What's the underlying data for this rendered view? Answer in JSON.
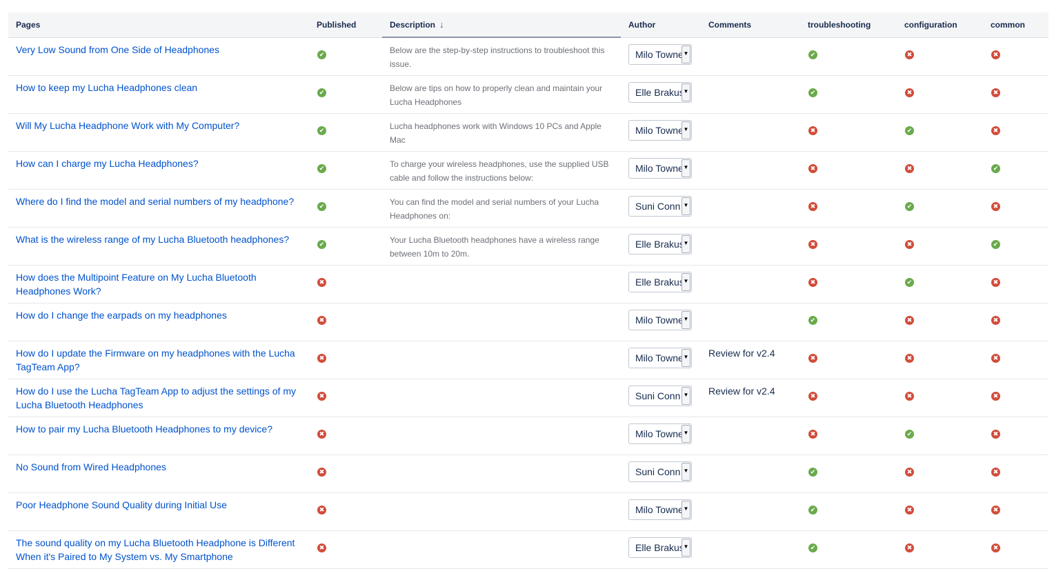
{
  "columns": {
    "pages": "Pages",
    "published": "Published",
    "description": "Description",
    "author": "Author",
    "comments": "Comments",
    "troubleshooting": "troubleshooting",
    "configuration": "configuration",
    "common": "common"
  },
  "sort": {
    "column": "description",
    "direction": "descending",
    "icon": "arrow-down-icon",
    "glyph": "↓"
  },
  "colors": {
    "link": "#0052cc",
    "yes": "#6aaa4c",
    "no": "#d14c3a"
  },
  "status_glyphs": {
    "yes": "✔",
    "no": "✖"
  },
  "rows": [
    {
      "page": "Very Low Sound from One Side of Headphones",
      "published": "yes",
      "description": "Below are the step-by-step instructions to troubleshoot this issue.",
      "author": "Milo Towne",
      "comments": "",
      "troubleshooting": "yes",
      "configuration": "no",
      "common": "no"
    },
    {
      "page": "How to keep my Lucha Headphones clean",
      "published": "yes",
      "description": "Below are tips on how to properly clean and maintain your Lucha Headphones",
      "author": "Elle Brakus",
      "comments": "",
      "troubleshooting": "yes",
      "configuration": "no",
      "common": "no"
    },
    {
      "page": "Will My Lucha Headphone Work with My Computer?",
      "published": "yes",
      "description": "Lucha headphones work with Windows 10 PCs and Apple Mac",
      "author": "Milo Towne",
      "comments": "",
      "troubleshooting": "no",
      "configuration": "yes",
      "common": "no"
    },
    {
      "page": "How can I charge my Lucha Headphones?",
      "published": "yes",
      "description": "To charge your wireless headphones, use the supplied USB cable and follow the instructions below:",
      "author": "Milo Towne",
      "comments": "",
      "troubleshooting": "no",
      "configuration": "no",
      "common": "yes"
    },
    {
      "page": "Where do I find the model and serial numbers of my headphone?",
      "published": "yes",
      "description": "You can find the model and serial numbers of your Lucha Headphones on:",
      "author": "Suni Conn",
      "comments": "",
      "troubleshooting": "no",
      "configuration": "yes",
      "common": "no"
    },
    {
      "page": "What is the wireless range of my Lucha Bluetooth headphones?",
      "published": "yes",
      "description": "Your Lucha Bluetooth headphones have a wireless range between 10m to 20m.",
      "author": "Elle Brakus",
      "comments": "",
      "troubleshooting": "no",
      "configuration": "no",
      "common": "yes"
    },
    {
      "page": "How does the Multipoint Feature on My Lucha Bluetooth Headphones Work?",
      "published": "no",
      "description": "",
      "author": "Elle Brakus",
      "comments": "",
      "troubleshooting": "no",
      "configuration": "yes",
      "common": "no"
    },
    {
      "page": "How do I change the earpads on my headphones",
      "published": "no",
      "description": "",
      "author": "Milo Towne",
      "comments": "",
      "troubleshooting": "yes",
      "configuration": "no",
      "common": "no"
    },
    {
      "page": "How do I update the Firmware on my headphones with the Lucha TagTeam App?",
      "published": "no",
      "description": "",
      "author": "Milo Towne",
      "comments": "Review for v2.4",
      "troubleshooting": "no",
      "configuration": "no",
      "common": "no"
    },
    {
      "page": "How do I use the Lucha TagTeam App to adjust the settings of my Lucha Bluetooth Headphones",
      "published": "no",
      "description": "",
      "author": "Suni Conn",
      "comments": "Review for v2.4",
      "troubleshooting": "no",
      "configuration": "no",
      "common": "no"
    },
    {
      "page": "How to pair my Lucha Bluetooth Headphones to my device?",
      "published": "no",
      "description": "",
      "author": "Milo Towne",
      "comments": "",
      "troubleshooting": "no",
      "configuration": "yes",
      "common": "no"
    },
    {
      "page": "No Sound from Wired Headphones",
      "published": "no",
      "description": "",
      "author": "Suni Conn",
      "comments": "",
      "troubleshooting": "yes",
      "configuration": "no",
      "common": "no"
    },
    {
      "page": "Poor Headphone Sound Quality during Initial Use",
      "published": "no",
      "description": "",
      "author": "Milo Towne",
      "comments": "",
      "troubleshooting": "yes",
      "configuration": "no",
      "common": "no"
    },
    {
      "page": "The sound quality on my Lucha Bluetooth Headphone is Different When it's Paired to My System vs. My Smartphone",
      "published": "no",
      "description": "",
      "author": "Elle Brakus",
      "comments": "",
      "troubleshooting": "yes",
      "configuration": "no",
      "common": "no"
    }
  ]
}
